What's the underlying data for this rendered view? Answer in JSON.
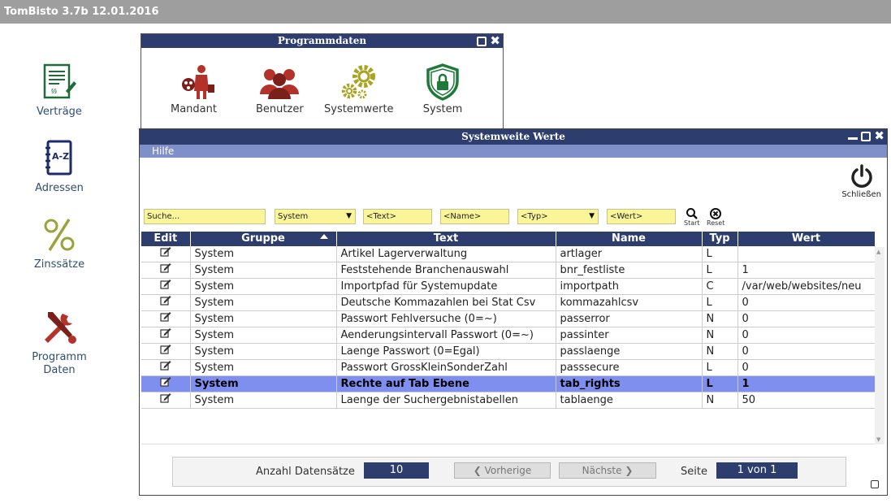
{
  "app": {
    "title": "TomBisto 3.7b 12.01.2016"
  },
  "desktop": [
    {
      "label": "Verträge",
      "icon": "contract-icon"
    },
    {
      "label": "Adressen",
      "icon": "address-book-icon"
    },
    {
      "label": "Zinssätze",
      "icon": "percent-icon"
    },
    {
      "label1": "Programm",
      "label2": "Daten",
      "icon": "tools-icon"
    }
  ],
  "programmdaten": {
    "title": "Programmdaten",
    "items": [
      {
        "label": "Mandant",
        "icon": "mandant-icon"
      },
      {
        "label": "Benutzer",
        "icon": "users-icon"
      },
      {
        "label": "Systemwerte",
        "icon": "gears-icon"
      },
      {
        "label": "System",
        "icon": "shield-lock-icon"
      }
    ]
  },
  "systemwerte": {
    "title": "Systemweite Werte",
    "menu": {
      "help": "Hilfe"
    },
    "close_label": "Schließen",
    "filters": {
      "search": "Suche...",
      "group": "System",
      "text": "<Text>",
      "name": "<Name>",
      "type": "<Typ>",
      "value": "<Wert>",
      "start": "Start",
      "reset": "Reset"
    },
    "columns": [
      "Edit",
      "Gruppe",
      "Text",
      "Name",
      "Typ",
      "Wert"
    ],
    "rows": [
      {
        "gruppe": "System",
        "text": "Artikel Lagerverwaltung",
        "name": "artlager",
        "typ": "L",
        "wert": ""
      },
      {
        "gruppe": "System",
        "text": "Feststehende Branchenauswahl",
        "name": "bnr_festliste",
        "typ": "L",
        "wert": "1"
      },
      {
        "gruppe": "System",
        "text": "Importpfad für Systemupdate",
        "name": "importpath",
        "typ": "C",
        "wert": "/var/web/websites/neu"
      },
      {
        "gruppe": "System",
        "text": "Deutsche Kommazahlen bei Stat Csv",
        "name": "kommazahlcsv",
        "typ": "L",
        "wert": "0"
      },
      {
        "gruppe": "System",
        "text": "Passwort Fehlversuche (0=~)",
        "name": "passerror",
        "typ": "N",
        "wert": "0"
      },
      {
        "gruppe": "System",
        "text": "Aenderungsintervall Passwort (0=~)",
        "name": "passinter",
        "typ": "N",
        "wert": "0"
      },
      {
        "gruppe": "System",
        "text": "Laenge Passwort (0=Egal)",
        "name": "passlaenge",
        "typ": "N",
        "wert": "0"
      },
      {
        "gruppe": "System",
        "text": "Passwort GrossKleinSonderZahl",
        "name": "passsecure",
        "typ": "L",
        "wert": "0"
      },
      {
        "gruppe": "System",
        "text": "Rechte auf Tab Ebene",
        "name": "tab_rights",
        "typ": "L",
        "wert": "1",
        "selected": true
      },
      {
        "gruppe": "System",
        "text": "Laenge der Suchergebnistabellen",
        "name": "tablaenge",
        "typ": "N",
        "wert": "50"
      }
    ],
    "pager": {
      "count_label": "Anzahl Datensätze",
      "count": "10",
      "prev": "❮ Vorherige",
      "next": "Nächste ❯",
      "page_label": "Seite",
      "page": "1 von 1"
    }
  }
}
